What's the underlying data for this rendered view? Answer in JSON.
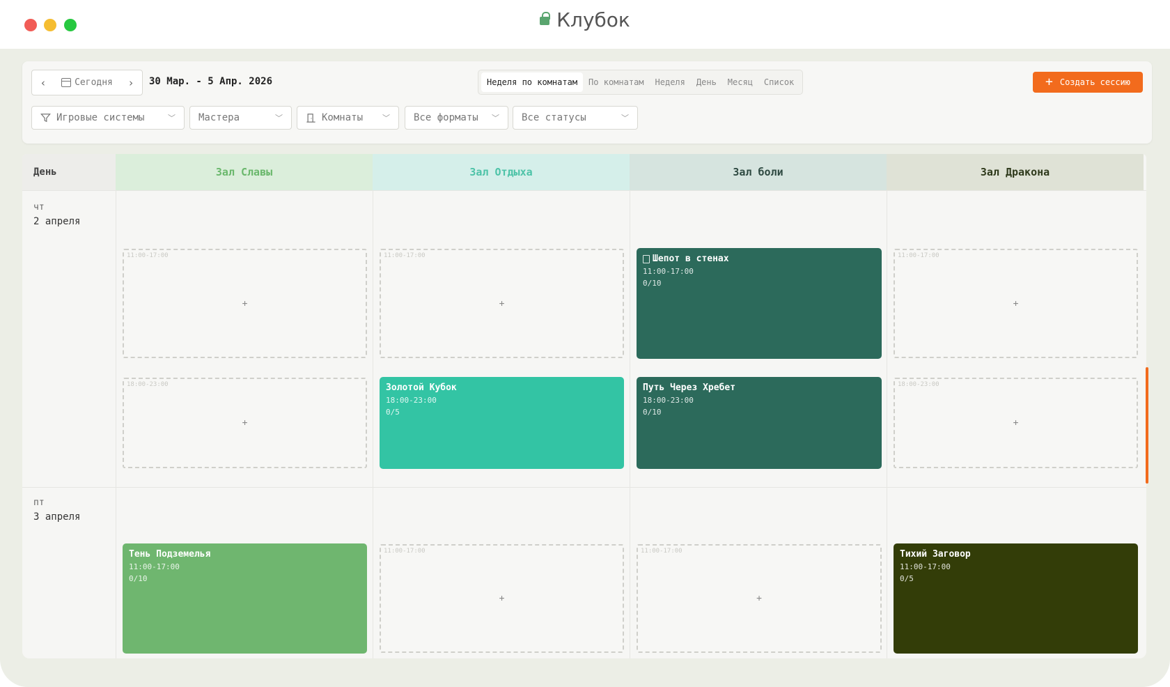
{
  "window": {
    "title": "Клубок"
  },
  "toolbar": {
    "today": "Сегодня",
    "date_range": "30 Мар. - 5 Апр. 2026",
    "views": [
      "Неделя по комнатам",
      "По комнатам",
      "Неделя",
      "День",
      "Месяц",
      "Список"
    ],
    "active_view": "Неделя по комнатам",
    "create_button": "Создать сессию"
  },
  "filters": {
    "systems": "Игровые системы",
    "masters": "Мастера",
    "rooms": "Комнаты",
    "formats": "Все форматы",
    "statuses": "Все статусы"
  },
  "grid": {
    "day_header": "День",
    "rooms": [
      {
        "name": "Зал Славы",
        "bg": "#dbeedb",
        "color": "#6bb86d"
      },
      {
        "name": "Зал Отдыха",
        "bg": "#d5efea",
        "color": "#4ec3a8"
      },
      {
        "name": "Зал боли",
        "bg": "#d6e4df",
        "color": "#2f4a42"
      },
      {
        "name": "Зал Дракона",
        "bg": "#dfe2d6",
        "color": "#2f3a1c"
      }
    ],
    "days": [
      {
        "dow": "чт",
        "date": "2 апреля"
      },
      {
        "dow": "пт",
        "date": "3 апреля"
      }
    ],
    "empty_slots": [
      {
        "time": "11:00-17:00",
        "plus": "+"
      },
      {
        "time": "11:00-17:00",
        "plus": "+"
      },
      {
        "time": "11:00-17:00",
        "plus": "+"
      },
      {
        "time": "18:00-23:00",
        "plus": "+"
      },
      {
        "time": "18:00-23:00",
        "plus": "+"
      },
      {
        "time": "11:00-17:00",
        "plus": "+"
      },
      {
        "time": "11:00-17:00",
        "plus": "+"
      }
    ],
    "events": [
      {
        "title": "Шепот в стенах",
        "time": "11:00-17:00",
        "capacity": "0/10",
        "color": "#2c6a5b",
        "icon": "document-icon"
      },
      {
        "title": "Золотой Кубок",
        "time": "18:00-23:00",
        "capacity": "0/5",
        "color": "#33c4a4"
      },
      {
        "title": "Путь Через Хребет",
        "time": "18:00-23:00",
        "capacity": "0/10",
        "color": "#2c6a5b"
      },
      {
        "title": "Тень Подземелья",
        "time": "11:00-17:00",
        "capacity": "0/10",
        "color": "#6fb66f"
      },
      {
        "title": "Тихий Заговор",
        "time": "11:00-17:00",
        "capacity": "0/5",
        "color": "#333d08"
      }
    ]
  },
  "colors": {
    "accent": "#f26b1d"
  }
}
